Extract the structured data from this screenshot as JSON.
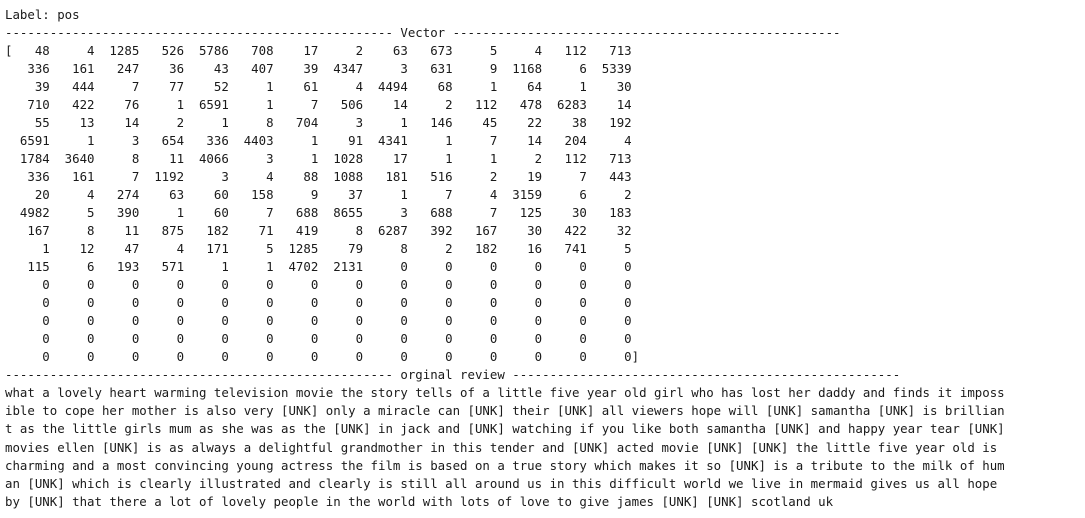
{
  "label_line": "Label: pos",
  "vector_header": "---------------------------------------------------- Vector ----------------------------------------------------",
  "vector_rows": [
    "[   48     4  1285   526  5786   708    17     2    63   673     5     4   112   713",
    "   336   161   247    36    43   407    39  4347     3   631     9  1168     6  5339",
    "    39   444     7    77    52     1    61     4  4494    68     1    64     1    30",
    "   710   422    76     1  6591     1     7   506    14     2   112   478  6283    14",
    "    55    13    14     2     1     8   704     3     1   146    45    22    38   192",
    "  6591     1     3   654   336  4403     1    91  4341     1     7    14   204     4",
    "  1784  3640     8    11  4066     3     1  1028    17     1     1     2   112   713",
    "   336   161     7  1192     3     4    88  1088   181   516     2    19     7   443",
    "    20     4   274    63    60   158     9    37     1     7     4  3159     6     2",
    "  4982     5   390     1    60     7   688  8655     3   688     7   125    30   183",
    "   167     8    11   875   182    71   419     8  6287   392   167    30   422    32",
    "     1    12    47     4   171     5  1285    79     8     2   182    16   741     5",
    "   115     6   193   571     1     1  4702  2131     0     0     0     0     0     0",
    "     0     0     0     0     0     0     0     0     0     0     0     0     0     0",
    "     0     0     0     0     0     0     0     0     0     0     0     0     0     0",
    "     0     0     0     0     0     0     0     0     0     0     0     0     0     0",
    "     0     0     0     0     0     0     0     0     0     0     0     0     0     0",
    "     0     0     0     0     0     0     0     0     0     0     0     0     0     0]"
  ],
  "review_header": "---------------------------------------------------- orginal review ----------------------------------------------------",
  "review_lines": [
    "what a lovely heart warming television movie the story tells of a little five year old girl who has lost her daddy and finds it imposs",
    "ible to cope her mother is also very [UNK] only a miracle can [UNK] their [UNK] all viewers hope will [UNK] samantha [UNK] is brillian",
    "t as the little girls mum as she was as the [UNK] in jack and [UNK] watching if you like both samantha [UNK] and happy year tear [UNK]",
    "movies ellen [UNK] is as always a delightful grandmother in this tender and [UNK] acted movie [UNK] [UNK] the little five year old is",
    "charming and a most convincing young actress the film is based on a true story which makes it so [UNK] is a tribute to the milk of hum",
    "an [UNK] which is clearly illustrated and clearly is still all around us in this difficult world we live in mermaid gives us all hope",
    "by [UNK] that there a lot of lovely people in the world with lots of love to give james [UNK] [UNK] scotland uk"
  ]
}
